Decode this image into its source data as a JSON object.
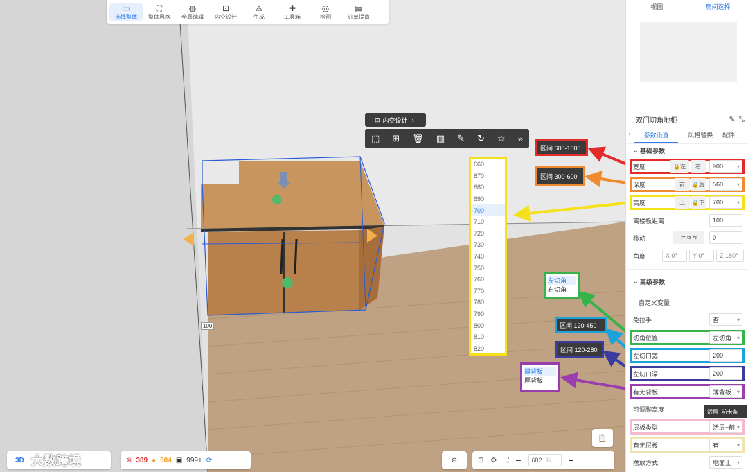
{
  "toolbar": {
    "items": [
      {
        "label": "选择整体",
        "icon": "select-icon",
        "active": true
      },
      {
        "label": "整体风格",
        "icon": "paint-roller-icon"
      },
      {
        "label": "全局编辑",
        "icon": "globe-edit-icon"
      },
      {
        "label": "内空设计",
        "icon": "interior-design-icon"
      },
      {
        "label": "生成",
        "icon": "generate-icon"
      },
      {
        "label": "工具箱",
        "icon": "puzzle-icon"
      },
      {
        "label": "检测",
        "icon": "detect-icon"
      },
      {
        "label": "订单提审",
        "icon": "order-icon"
      }
    ]
  },
  "floating": {
    "breadcrumb": "内空设计",
    "tools": [
      "select-box-icon",
      "add-icon",
      "trash-icon",
      "split-icon",
      "brush-icon",
      "rotate-icon",
      "star-icon",
      "more-icon"
    ]
  },
  "height_options": [
    "660",
    "670",
    "680",
    "690",
    "700",
    "710",
    "720",
    "730",
    "740",
    "750",
    "760",
    "770",
    "780",
    "790",
    "800",
    "810",
    "820"
  ],
  "height_selected": "700",
  "dimension_label": "100",
  "annotations": {
    "width_range": "区间 600-1000",
    "depth_range": "区间 300-600",
    "cut_width_range": "区间 120-450",
    "cut_depth_range": "区间 120-280",
    "corner_options": [
      "左切角",
      "右切角"
    ],
    "backboard_options": [
      "薄背板",
      "厚背板"
    ],
    "layer_tooltip": "活层+前卡条"
  },
  "panel": {
    "view_tabs": [
      "视图",
      "房间选择"
    ],
    "title": "双门切角地柜",
    "tabs": [
      "参数设置",
      "风格替换",
      "配件"
    ],
    "basic_section": "基础参数",
    "width": {
      "label": "宽度",
      "left": "左",
      "right": "右",
      "value": "900"
    },
    "depth": {
      "label": "深度",
      "front": "前",
      "back": "后",
      "value": "560"
    },
    "height": {
      "label": "高度",
      "top": "上",
      "bottom": "下",
      "value": "700"
    },
    "floor_gap": {
      "label": "离楼板距离",
      "value": "100"
    },
    "move": {
      "label": "移动",
      "value": "0"
    },
    "angle": {
      "label": "角度",
      "x": "X 0°",
      "y": "Y 0°",
      "z": "Z 180°"
    },
    "advanced_section": "高级参数",
    "custom_vars": "自定义变量",
    "no_handle": {
      "label": "免拉手",
      "value": "否"
    },
    "cut_pos": {
      "label": "切角位置",
      "value": "左切角"
    },
    "cut_width": {
      "label": "左切口宽",
      "value": "200"
    },
    "cut_depth": {
      "label": "左切口深",
      "value": "200"
    },
    "backboard": {
      "label": "有无背板",
      "value": "薄背板"
    },
    "adjustable_feet": {
      "label": "可调脚高度"
    },
    "layer_type": {
      "label": "层板类型",
      "value": "活层+前"
    },
    "layer_has": {
      "label": "有无层板",
      "value": "有"
    },
    "placement": {
      "label": "摆放方式",
      "value": "地面上"
    }
  },
  "bottom": {
    "mode": "3D",
    "errors": "309",
    "warnings": "504",
    "count": "999+",
    "zoom": "682",
    "zoom_unit": "%",
    "watermark": "大数跨境"
  }
}
